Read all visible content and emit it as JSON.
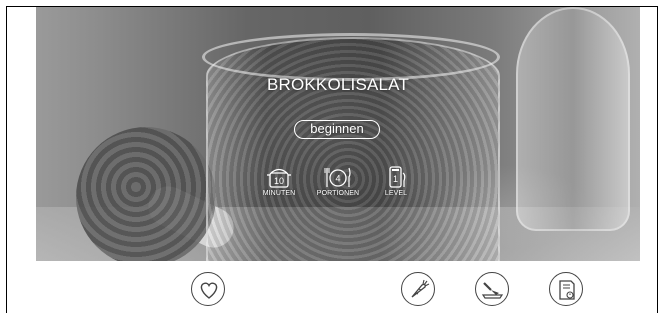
{
  "recipe": {
    "title": "BROKKOLISALAT",
    "start_label": "beginnen"
  },
  "stats": [
    {
      "value": "10",
      "label": "MINUTEN",
      "icon": "pot-icon"
    },
    {
      "value": "4",
      "label": "PORTIONEN",
      "icon": "plate-cutlery-icon"
    },
    {
      "value": "1",
      "label": "LEVEL",
      "icon": "chef-knife-level-icon"
    }
  ],
  "actions": {
    "favorite": "heart-icon",
    "ingredients": "carrot-icon",
    "preparation": "cutting-board-knife-icon",
    "shopping": "recipe-card-icon"
  },
  "colors": {
    "overlay_text": "#ffffff",
    "button_outline": "#444444"
  }
}
